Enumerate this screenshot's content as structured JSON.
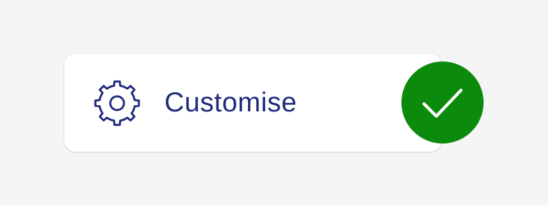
{
  "option": {
    "label": "Customise",
    "icon": "gear-icon",
    "selected": true,
    "selected_icon": "checkmark-icon"
  },
  "colors": {
    "page_background": "#f5f5f5",
    "card_background": "#ffffff",
    "label_text": "#1f2a7a",
    "icon_stroke": "#1f2a7a",
    "check_badge": "#0b8a0b",
    "check_mark": "#ffffff"
  }
}
